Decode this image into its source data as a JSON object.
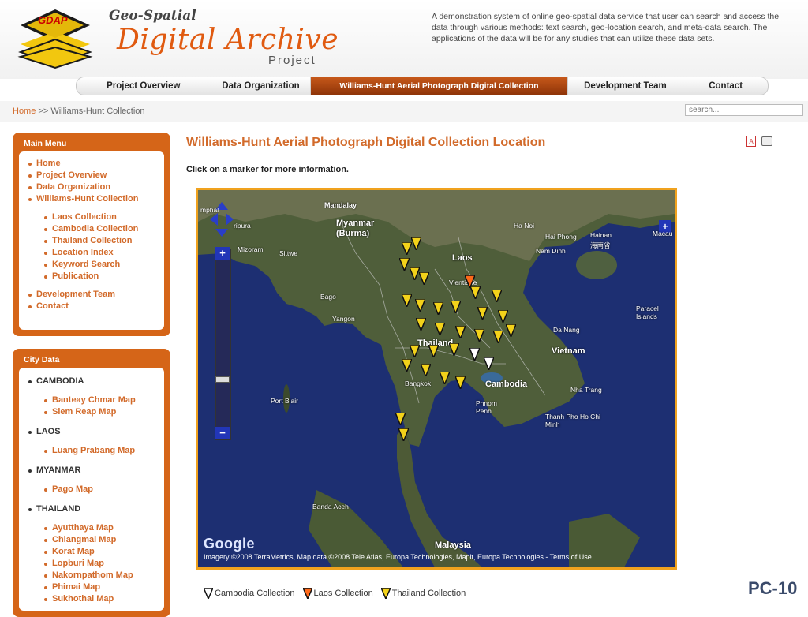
{
  "header": {
    "logo_text": "GDAP",
    "title_small": "Geo-Spatial",
    "title_main": "Digital Archive",
    "title_sub": "Project",
    "description": "A demonstration system of online geo-spatial data service that user can search and access the data through various methods: text search, geo-location search, and meta-data search. The applications of the data will be for any studies that can utilize these data sets."
  },
  "nav": {
    "items": [
      {
        "label": "Project Overview"
      },
      {
        "label": "Data Organization"
      },
      {
        "label": "Williams-Hunt Aerial Photograph Digital Collection",
        "active": true
      },
      {
        "label": "Development Team"
      },
      {
        "label": "Contact"
      }
    ]
  },
  "breadcrumb": {
    "home": "Home",
    "separator": ">>",
    "current": "Williams-Hunt Collection"
  },
  "search": {
    "placeholder": "search..."
  },
  "main_menu": {
    "title": "Main Menu",
    "items": [
      "Home",
      "Project Overview",
      "Data Organization",
      "Williams-Hunt Collection"
    ],
    "sub_items": [
      "Laos Collection",
      "Cambodia Collection",
      "Thailand Collection",
      "Location Index",
      "Keyword Search",
      "Publication"
    ],
    "bottom_items": [
      "Development Team",
      "Contact"
    ]
  },
  "city_data": {
    "title": "City Data",
    "countries": [
      {
        "name": "CAMBODIA",
        "maps": [
          "Banteay Chmar Map",
          "Siem Reap Map"
        ]
      },
      {
        "name": "LAOS",
        "maps": [
          "Luang Prabang Map"
        ]
      },
      {
        "name": "MYANMAR",
        "maps": [
          "Pago Map"
        ]
      },
      {
        "name": "THAILAND",
        "maps": [
          "Ayutthaya Map",
          "Chiangmai Map",
          "Korat Map",
          "Lopburi Map",
          "Nakornpathom Map",
          "Phimai Map",
          "Sukhothai Map"
        ]
      }
    ]
  },
  "content": {
    "title": "Williams-Hunt Aerial Photograph Digital Collection Location",
    "instructions": "Click on a marker for more information.",
    "pdf_icon": "pdf-icon",
    "print_icon": "print-icon"
  },
  "map": {
    "google_logo": "Google",
    "attribution": "Imagery ©2008 TerraMetrics, Map data ©2008 Tele Atlas, Europa Technologies, Mapit, Europa Technologies - Terms of Use",
    "labels": {
      "mandalay": "Mandalay",
      "myanmar": "Myanmar",
      "burma": "(Burma)",
      "imphal": "mphal",
      "lipura": "ripura",
      "mizoram": "Mizoram",
      "sittwe": "Sittwe",
      "laos": "Laos",
      "hanoi": "Ha Noi",
      "haiphong": "Hai Phong",
      "hainan": "Hainan",
      "hainan_cn": "海南省",
      "namdinh": "Nam Dinh",
      "vientiane": "Vientiane",
      "bago": "Bago",
      "yangon": "Yangon",
      "thailand": "Thailand",
      "danang": "Da Nang",
      "vietnam": "Vietnam",
      "paracel": "Paracel Islands",
      "bangkok": "Bangkok",
      "cambodia": "Cambodia",
      "phnompenh": "Phnom Penh",
      "hcmc": "Thanh Pho Ho Chi Minh",
      "portblair": "Port Blair",
      "bandaaceh": "Banda Aceh",
      "malaysia": "Malaysia",
      "nhatrang": "Nha Trang",
      "macau": "Macau"
    }
  },
  "legend": {
    "items": [
      {
        "label": "Cambodia Collection",
        "color": "#ffffff"
      },
      {
        "label": "Laos Collection",
        "color": "#ff6a1a"
      },
      {
        "label": "Thailand Collection",
        "color": "#f3d21a"
      }
    ]
  },
  "slide_label": "PC-10"
}
